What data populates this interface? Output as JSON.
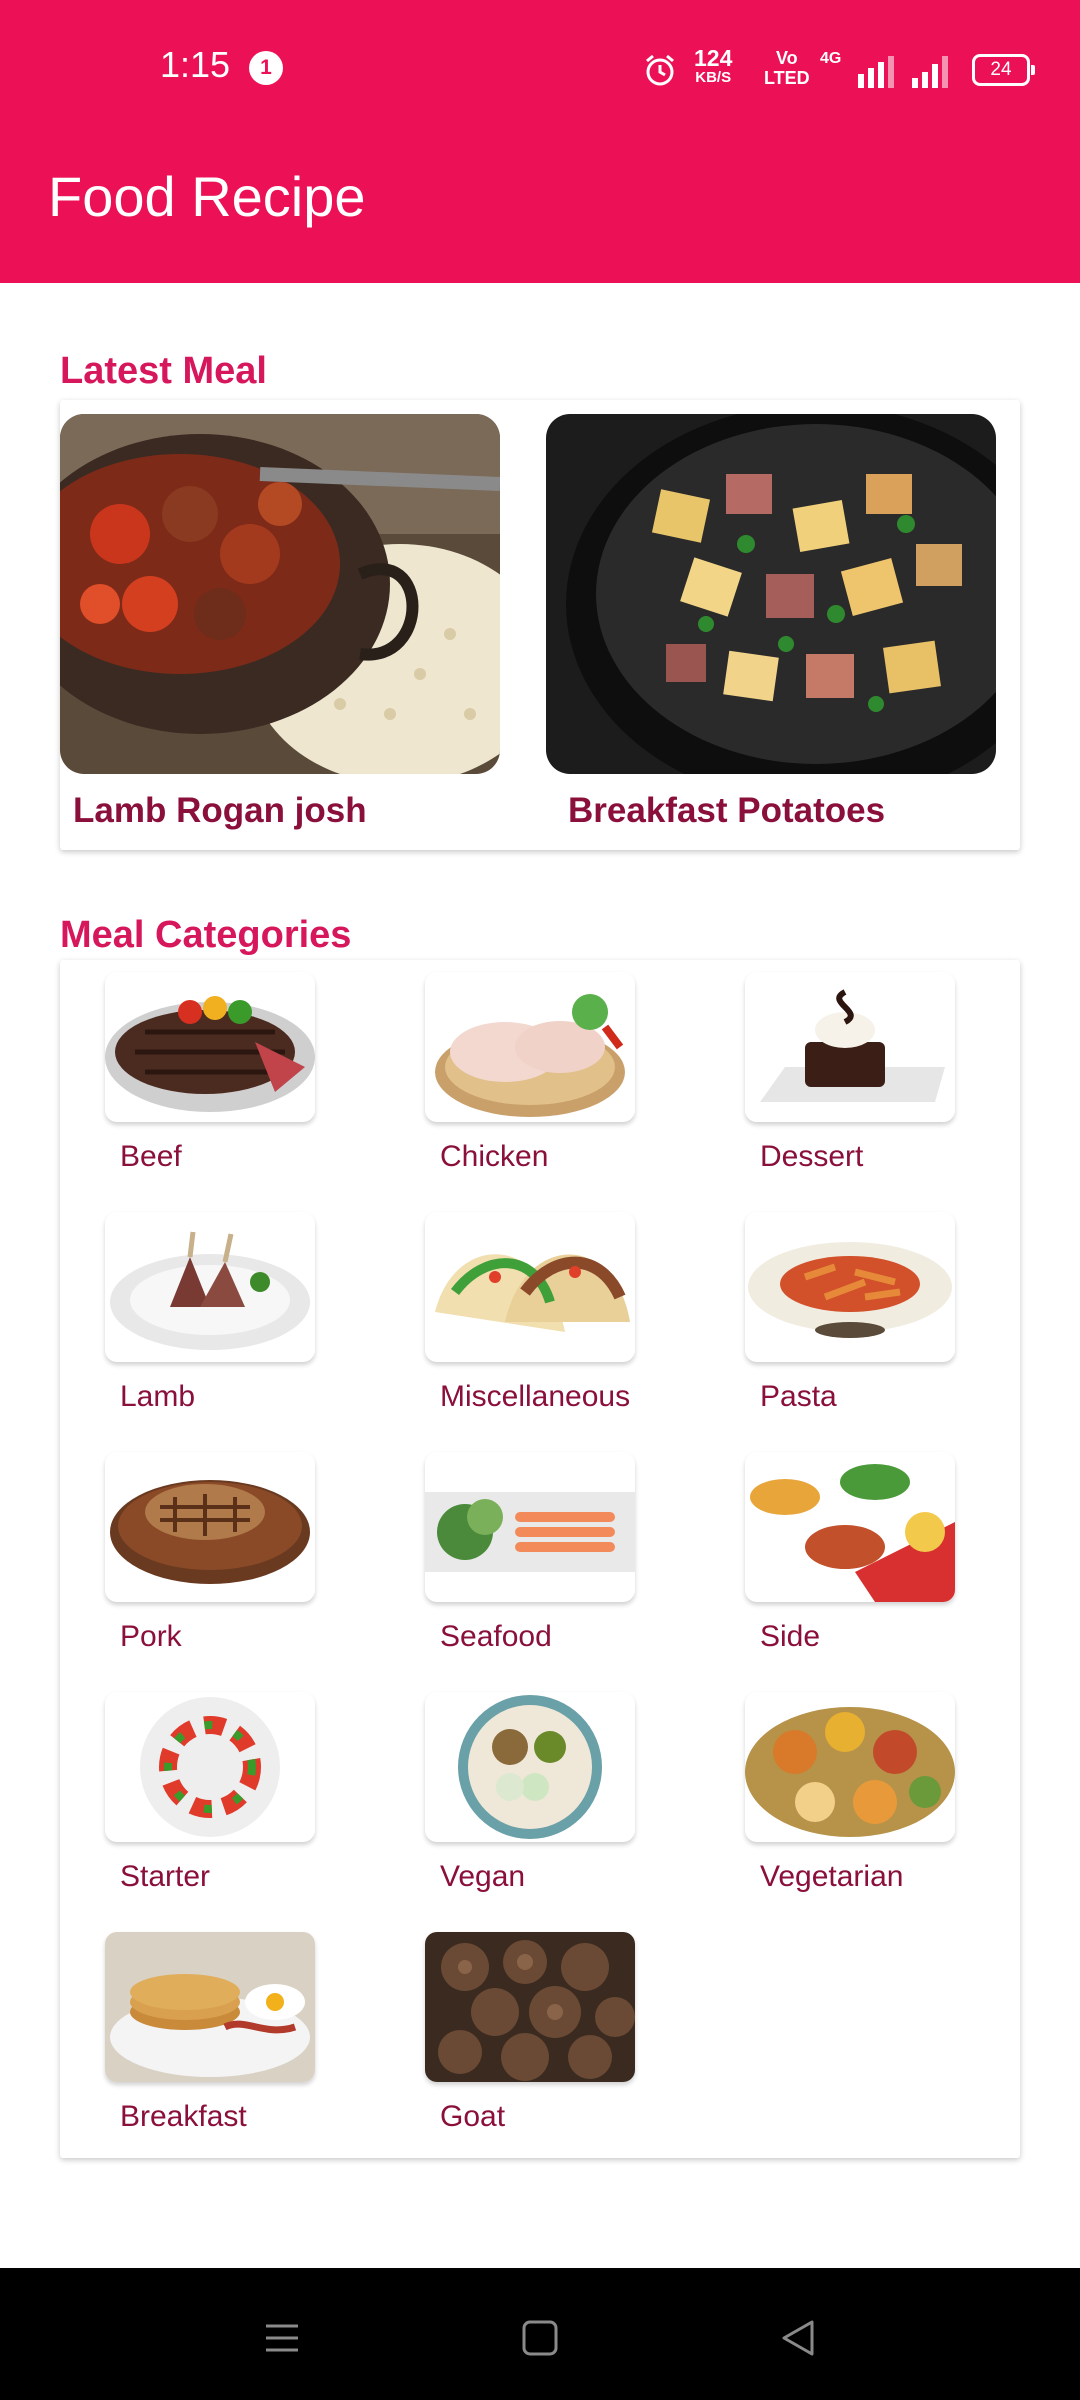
{
  "status": {
    "time": "1:15",
    "notification_count": "1",
    "speed_value": "124",
    "speed_unit": "KB/S",
    "volte_top": "Vo",
    "volte_bottom": "LTED",
    "network": "4G",
    "battery": "24",
    "icons": [
      "alarm-icon",
      "signal-icon",
      "battery-icon"
    ]
  },
  "app_bar": {
    "title": "Food Recipe"
  },
  "latest": {
    "title": "Latest Meal",
    "meals": [
      {
        "name": "Lamb Rogan josh"
      },
      {
        "name": "Breakfast Potatoes"
      }
    ]
  },
  "categories": {
    "title": "Meal Categories",
    "items": [
      {
        "label": "Beef"
      },
      {
        "label": "Chicken"
      },
      {
        "label": "Dessert"
      },
      {
        "label": "Lamb"
      },
      {
        "label": "Miscellaneous"
      },
      {
        "label": "Pasta"
      },
      {
        "label": "Pork"
      },
      {
        "label": "Seafood"
      },
      {
        "label": "Side"
      },
      {
        "label": "Starter"
      },
      {
        "label": "Vegan"
      },
      {
        "label": "Vegetarian"
      },
      {
        "label": "Breakfast"
      },
      {
        "label": "Goat"
      }
    ]
  },
  "nav": {
    "icons": [
      "menu-icon",
      "home-icon",
      "back-icon"
    ]
  },
  "colors": {
    "primary": "#EC1157",
    "accent_text": "#D6175C",
    "label_text": "#8A0F3A"
  }
}
